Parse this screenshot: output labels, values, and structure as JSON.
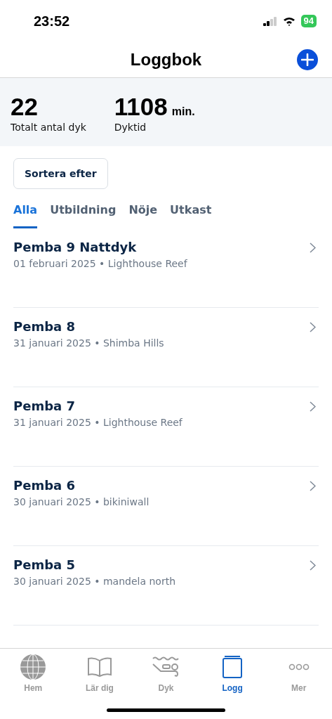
{
  "status_bar": {
    "time": "23:52",
    "battery": "94"
  },
  "header": {
    "title": "Loggbok"
  },
  "stats": [
    {
      "value": "22",
      "label": "Totalt antal dyk"
    },
    {
      "value": "1108",
      "unit": "min.",
      "label": "Dyktid"
    }
  ],
  "sort_button": "Sortera efter",
  "filter_tabs": [
    {
      "label": "Alla",
      "selected": true
    },
    {
      "label": "Utbildning",
      "selected": false
    },
    {
      "label": "Nöje",
      "selected": false
    },
    {
      "label": "Utkast",
      "selected": false
    }
  ],
  "dives": [
    {
      "title": "Pemba 9 Nattdyk",
      "subtitle": "01 februari 2025 • Lighthouse Reef"
    },
    {
      "title": "Pemba 8",
      "subtitle": "31 januari 2025 • Shimba Hills"
    },
    {
      "title": "Pemba 7",
      "subtitle": "31 januari 2025 • Lighthouse Reef"
    },
    {
      "title": "Pemba 6",
      "subtitle": "30 januari 2025 • bikiniwall"
    },
    {
      "title": "Pemba 5",
      "subtitle": "30 januari 2025 • mandela north"
    }
  ],
  "tab_bar": [
    {
      "label": "Hem",
      "selected": false
    },
    {
      "label": "Lär dig",
      "selected": false
    },
    {
      "label": "Dyk",
      "selected": false
    },
    {
      "label": "Logg",
      "selected": true
    },
    {
      "label": "Mer",
      "selected": false
    }
  ]
}
